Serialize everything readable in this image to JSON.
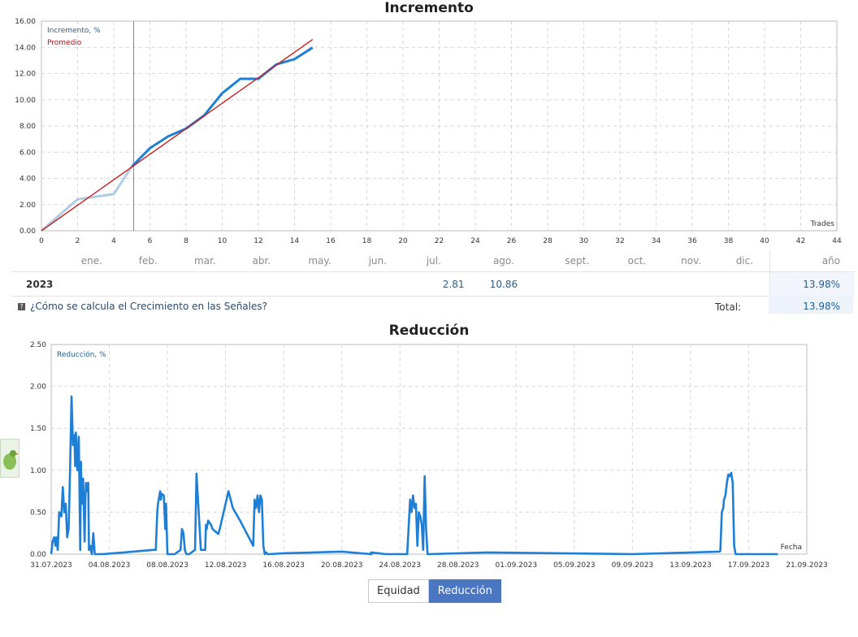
{
  "chart_data": [
    {
      "type": "line",
      "title": "Incremento",
      "xlabel": "Trades",
      "ylabel": "",
      "xlim": [
        0,
        44
      ],
      "ylim": [
        0,
        16
      ],
      "x_ticks": [
        0,
        2,
        4,
        6,
        8,
        10,
        12,
        14,
        16,
        18,
        20,
        22,
        24,
        26,
        28,
        30,
        32,
        34,
        36,
        38,
        40,
        42,
        44
      ],
      "y_ticks": [
        "0.00",
        "2.00",
        "4.00",
        "6.00",
        "8.00",
        "10.00",
        "12.00",
        "14.00",
        "16.00"
      ],
      "grid": true,
      "legend_position": "top-left",
      "marker_x": 5.1,
      "series": [
        {
          "name": "Incremento, %",
          "color": "#1e7fd6",
          "color_before_marker": "#b0cbe3",
          "x": [
            0,
            1,
            2,
            3,
            4,
            5,
            6,
            7,
            8,
            9,
            10,
            11,
            12,
            13,
            14,
            15
          ],
          "y": [
            0,
            1.2,
            2.4,
            2.6,
            2.8,
            4.9,
            6.3,
            7.2,
            7.8,
            8.8,
            10.5,
            11.6,
            11.6,
            12.7,
            13.1,
            13.98
          ]
        },
        {
          "name": "Promedio",
          "color": "#cc2020",
          "x": [
            0,
            15
          ],
          "y": [
            0,
            14.6
          ]
        }
      ]
    },
    {
      "type": "line",
      "title": "Reducción",
      "xlabel": "Fecha",
      "ylabel": "",
      "ylim": [
        0,
        2.5
      ],
      "x_domain_days": [
        0,
        52
      ],
      "x_ticks": [
        "31.07.2023",
        "04.08.2023",
        "08.08.2023",
        "12.08.2023",
        "16.08.2023",
        "20.08.2023",
        "24.08.2023",
        "28.08.2023",
        "01.09.2023",
        "05.09.2023",
        "09.09.2023",
        "13.09.2023",
        "17.09.2023",
        "21.09.2023"
      ],
      "y_ticks": [
        "0.00",
        "0.50",
        "1.00",
        "1.50",
        "2.00",
        "2.50"
      ],
      "grid": true,
      "legend_position": "top-left",
      "series": [
        {
          "name": "Reducción, %",
          "color": "#1e7fd6",
          "x": [
            0,
            0.1,
            0.2,
            0.3,
            0.35,
            0.45,
            0.55,
            0.7,
            0.8,
            0.9,
            1.0,
            1.1,
            1.2,
            1.3,
            1.4,
            1.5,
            1.6,
            1.65,
            1.7,
            1.8,
            1.9,
            2.0,
            2.05,
            2.1,
            2.2,
            2.3,
            2.35,
            2.4,
            2.5,
            2.55,
            2.6,
            2.7,
            2.75,
            2.8,
            2.9,
            3.0,
            3.5,
            5.0,
            7.0,
            7.2,
            7.3,
            7.35,
            7.5,
            7.55,
            7.6,
            7.75,
            7.85,
            7.9,
            8.0,
            8.5,
            8.9,
            9.0,
            9.1,
            9.2,
            9.3,
            9.5,
            9.9,
            10.0,
            10.3,
            10.6,
            10.65,
            10.7,
            10.8,
            11.0,
            11.1,
            11.5,
            11.6,
            12.2,
            12.5,
            13.0,
            13.9,
            14.0,
            14.05,
            14.1,
            14.2,
            14.3,
            14.4,
            14.5,
            14.6,
            14.7,
            14.8,
            14.9,
            15.0,
            16.0,
            20.0,
            22.0,
            22.01,
            22.05,
            22.06,
            23.0,
            24.5,
            24.7,
            24.8,
            24.9,
            25.0,
            25.1,
            25.2,
            25.3,
            25.4,
            25.5,
            25.6,
            25.7,
            25.8,
            25.9,
            26.0,
            30.0,
            40.0,
            46.0,
            46.05,
            46.15,
            46.25,
            46.3,
            46.4,
            46.5,
            46.6,
            46.7,
            46.8,
            46.9,
            47.0,
            47.1,
            48.0,
            50.0
          ],
          "y": [
            0,
            0.15,
            0.2,
            0.1,
            0.2,
            0.05,
            0.5,
            0.45,
            0.8,
            0.5,
            0.6,
            0.2,
            0.3,
            1.0,
            1.88,
            1.3,
            1.42,
            1.05,
            1.45,
            1.0,
            1.4,
            0.05,
            1.1,
            0.6,
            0.9,
            0.15,
            0.65,
            0.85,
            0.75,
            0.85,
            0.05,
            0.1,
            0.03,
            0.0,
            0.25,
            0.0,
            0.0,
            0.02,
            0.05,
            0.05,
            0.5,
            0.6,
            0.75,
            0.65,
            0.72,
            0.7,
            0.3,
            0.6,
            0.0,
            0.0,
            0.05,
            0.3,
            0.25,
            0.05,
            0.0,
            0.0,
            0.05,
            0.96,
            0.05,
            0.05,
            0.35,
            0.3,
            0.4,
            0.35,
            0.3,
            0.24,
            0.3,
            0.75,
            0.55,
            0.4,
            0.1,
            0.65,
            0.6,
            0.55,
            0.7,
            0.5,
            0.7,
            0.65,
            0.1,
            0.0,
            0.02,
            0.0,
            0.0,
            0.01,
            0.03,
            0.0,
            0.02,
            0.0,
            0.02,
            0.0,
            0.0,
            0.65,
            0.5,
            0.7,
            0.55,
            0.6,
            0.1,
            0.5,
            0.45,
            0.35,
            0.05,
            0.93,
            0.3,
            0.0,
            0.0,
            0.02,
            0.0,
            0.03,
            0.04,
            0.5,
            0.55,
            0.65,
            0.7,
            0.85,
            0.95,
            0.93,
            0.97,
            0.85,
            0.1,
            0.0,
            0.0,
            0.0
          ]
        }
      ]
    }
  ],
  "monthly": {
    "months": [
      "ene.",
      "feb.",
      "mar.",
      "abr.",
      "may.",
      "jun.",
      "jul.",
      "ago.",
      "sept.",
      "oct.",
      "nov.",
      "dic."
    ],
    "year_header": "año",
    "rows": [
      {
        "year": "2023",
        "values": [
          "",
          "",
          "",
          "",
          "",
          "",
          "2.81",
          "10.86",
          "",
          "",
          "",
          ""
        ],
        "year_value": "13.98%"
      }
    ],
    "total_label": "Total:",
    "total_value": "13.98%"
  },
  "help_link": "¿Cómo se calcula el Crecimiento en las Señales?",
  "tabs": {
    "equity": "Equidad",
    "drawdown": "Reducción"
  },
  "colors": {
    "accent": "#4a76c2",
    "series_blue": "#1e7fd6",
    "average_red": "#cc2020"
  }
}
